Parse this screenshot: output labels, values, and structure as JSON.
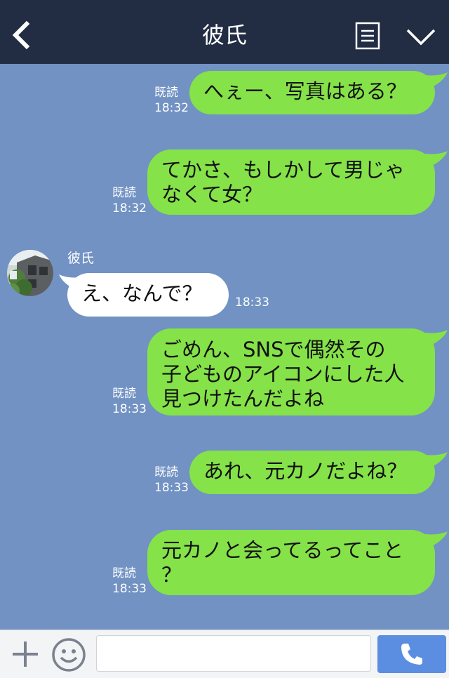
{
  "header": {
    "title": "彼氏"
  },
  "messages": [
    {
      "direction": "out",
      "text": "へぇー、写真はある？",
      "read": "既読",
      "time": "18:32"
    },
    {
      "direction": "out",
      "text": "てかさ、もしかして男じゃ\nなくて女？",
      "read": "既読",
      "time": "18:32"
    },
    {
      "direction": "in",
      "sender": "彼氏",
      "text": "え、なんで？",
      "time": "18:33"
    },
    {
      "direction": "out",
      "text": "ごめん、SNSで偶然その\n子どものアイコンにした人\n見つけたんだよね",
      "read": "既読",
      "time": "18:33"
    },
    {
      "direction": "out",
      "text": "あれ、元カノだよね？",
      "read": "既読",
      "time": "18:33"
    },
    {
      "direction": "out",
      "text": "元カノと会ってるってこと\n？",
      "read": "既読",
      "time": "18:33"
    }
  ],
  "input_bar": {
    "message_value": "",
    "message_placeholder": ""
  },
  "colors": {
    "header_bg": "#222d44",
    "chat_bg": "#7192c3",
    "outgoing_bubble": "#85e249",
    "incoming_bubble": "#ffffff",
    "call_button": "#5b8ee0"
  },
  "icons": [
    "back-arrow-icon",
    "notes-icon",
    "chevron-down-icon",
    "plus-icon",
    "emoji-icon",
    "phone-icon"
  ]
}
